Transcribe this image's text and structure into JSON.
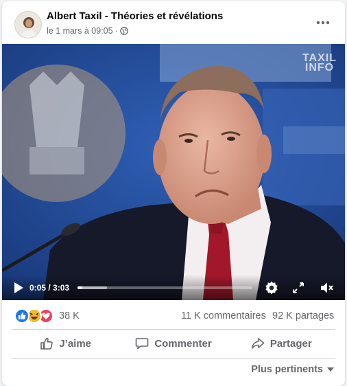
{
  "post": {
    "page_name": "Albert Taxil - Théories et révélations",
    "date": "le 1 mars à 09:05",
    "separator": "·",
    "privacy_icon": "globe-icon",
    "more_icon": "more-dots-icon"
  },
  "video": {
    "watermark_line1": "TAXIL",
    "watermark_line2": "INFO",
    "time": "0:05 / 3:03",
    "progress": 0.027,
    "buffered": 0.17,
    "icons": [
      "play-icon",
      "settings-gear-icon",
      "fullscreen-icon",
      "volume-muted-icon"
    ]
  },
  "reactions": {
    "types": [
      "like",
      "haha",
      "love"
    ],
    "count": "38 K",
    "comments": "11 K commentaires",
    "shares": "92 K partages"
  },
  "actions": {
    "like": "J’aime",
    "comment": "Commenter",
    "share": "Partager"
  },
  "sort": {
    "label": "Plus pertinents",
    "icon": "caret-down-icon"
  },
  "colors": {
    "like_blue": "#1877f2",
    "haha_yellow": "#f7b928",
    "love_red": "#f33e58",
    "secondary_text": "#65676b",
    "video_background": "#1f3f86"
  }
}
